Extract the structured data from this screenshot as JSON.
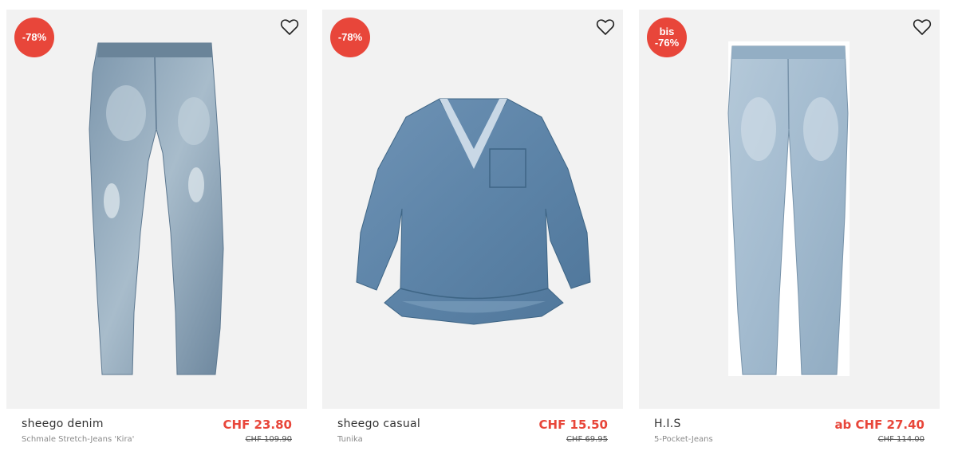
{
  "products": [
    {
      "badge_line1": "-78%",
      "badge_line2": "",
      "brand": "sheego denim",
      "name": "Schmale Stretch-Jeans 'Kira'",
      "price": "CHF 23.80",
      "old_price": "CHF 109.90",
      "image_icon": "jeans-image"
    },
    {
      "badge_line1": "-78%",
      "badge_line2": "",
      "brand": "sheego casual",
      "name": "Tunika",
      "price": "CHF 15.50",
      "old_price": "CHF 69.95",
      "image_icon": "tunic-image"
    },
    {
      "badge_line1": "bis",
      "badge_line2": "-76%",
      "brand": "H.I.S",
      "name": "5-Pocket-Jeans",
      "price": "ab CHF 27.40",
      "old_price": "CHF 114.00",
      "image_icon": "jeans-image"
    }
  ],
  "colors": {
    "accent": "#e8463a",
    "card_background": "#f2f2f2",
    "denim_dark": "#6f8aa3",
    "denim_light": "#a9c0d3"
  }
}
